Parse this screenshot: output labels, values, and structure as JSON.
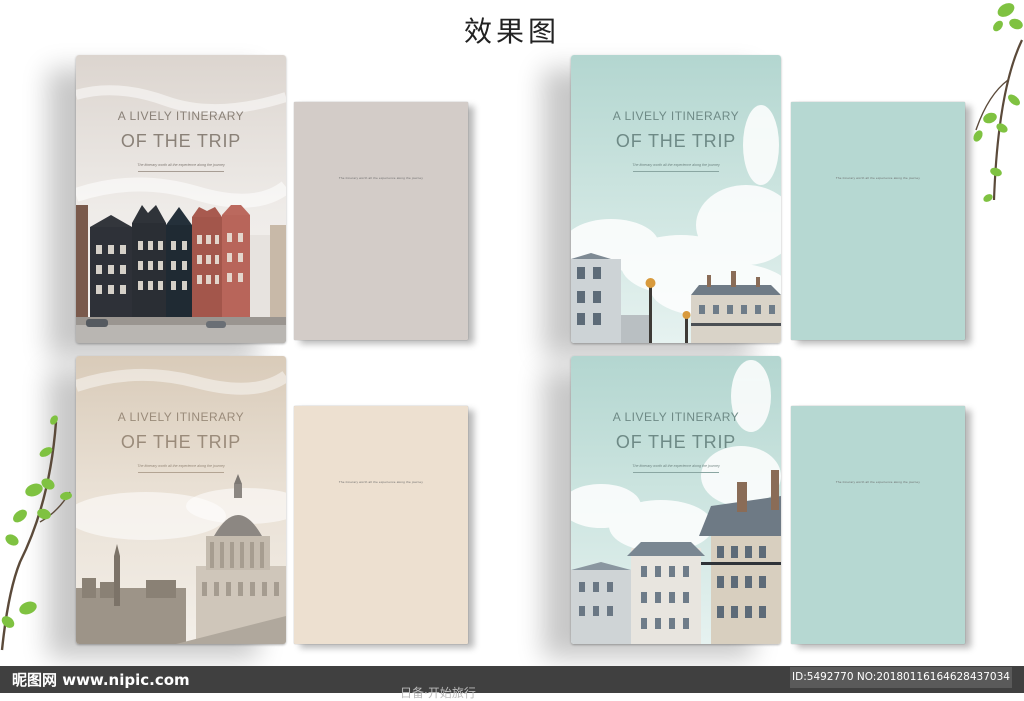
{
  "page_title": "效果图",
  "books": [
    {
      "id": "amsterdam",
      "cover_subtitle": "A LIVELY ITINERARY",
      "cover_title": "OF THE TRIP",
      "cover_tagline": "The itinerary worth all the experience along the journey",
      "back_text": "The itinerary worth all the experience along the journey",
      "colors": {
        "cover_top": "#d9d2cc",
        "cover_bottom": "#f2efec",
        "back": "#d2cbc7",
        "text": "#8a8178"
      }
    },
    {
      "id": "paris-teal-1",
      "cover_subtitle": "A LIVELY ITINERARY",
      "cover_title": "OF THE TRIP",
      "cover_tagline": "The itinerary worth all the experience along the journey",
      "back_text": "The itinerary worth all the experience along the journey",
      "colors": {
        "cover_top": "#b6d8d2",
        "cover_bottom": "#e4f1ef",
        "back": "#b6d8d2",
        "text": "#6e8a86"
      }
    },
    {
      "id": "london-beige",
      "cover_subtitle": "A LIVELY ITINERARY",
      "cover_title": "OF THE TRIP",
      "cover_tagline": "The itinerary worth all the experience along the journey",
      "back_text": "The itinerary worth all the experience along the journey",
      "colors": {
        "cover_top": "#dccfbf",
        "cover_bottom": "#f1ebe3",
        "back": "#ede0d1",
        "text": "#9a8b7a"
      }
    },
    {
      "id": "paris-teal-2",
      "cover_subtitle": "A LIVELY ITINERARY",
      "cover_title": "OF THE TRIP",
      "cover_tagline": "The itinerary worth all the experience along the journey",
      "back_text": "The itinerary worth all the experience along the journey",
      "colors": {
        "cover_top": "#b6d8d2",
        "cover_bottom": "#e4f1ef",
        "back": "#b6d8d2",
        "text": "#6e8a86"
      }
    }
  ],
  "footer": {
    "site": "昵图网 www.nipic.com",
    "id_text": "ID:5492770 NO:20180116164628437034",
    "sub_text": "日备·开始旅行",
    "bar_color": "#404040"
  },
  "decor": {
    "branch_leaf_color": "#7fc241",
    "branch_stem_color": "#5b4a3a"
  }
}
